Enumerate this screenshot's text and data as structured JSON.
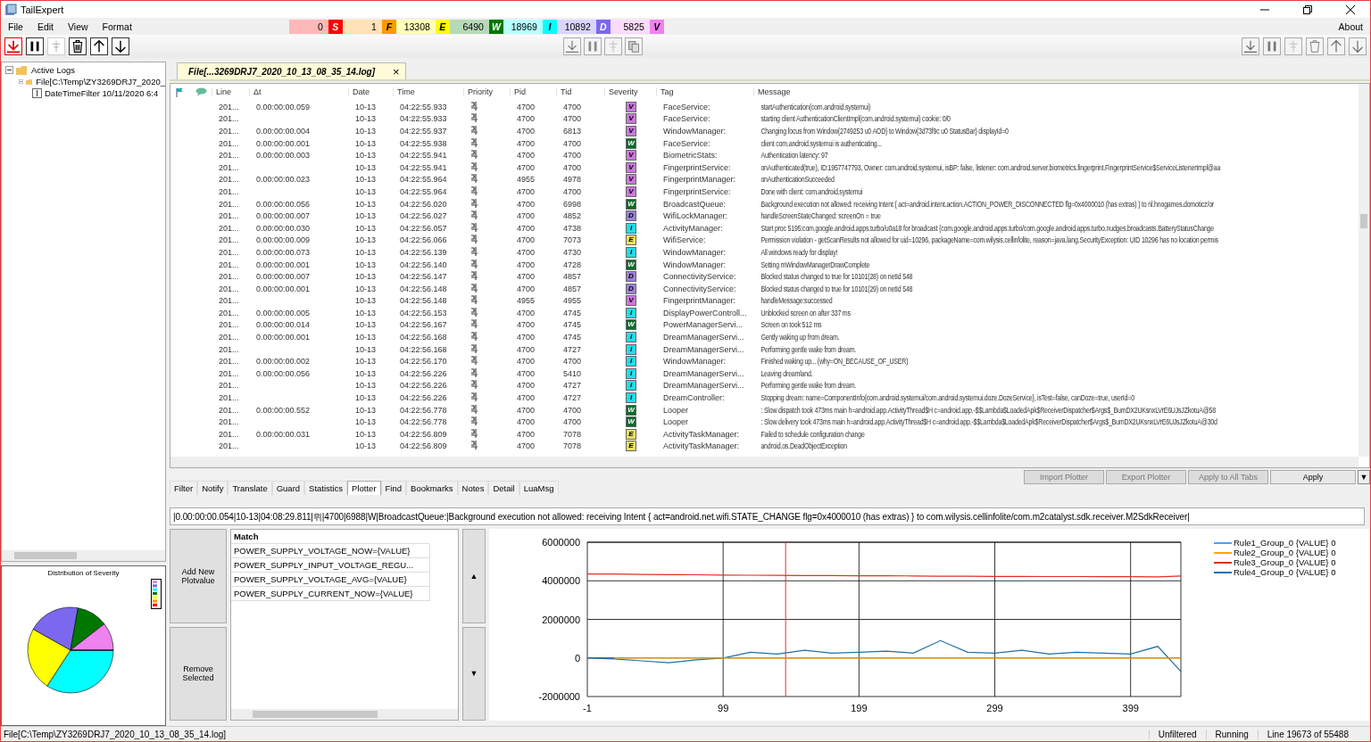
{
  "window": {
    "title": "TailExpert"
  },
  "menu": [
    "File",
    "Edit",
    "View",
    "Format"
  ],
  "menu_right": "About",
  "severity_counts": [
    {
      "count": "0",
      "label": "S",
      "color": "#ff0000"
    },
    {
      "count": "1",
      "label": "F",
      "color": "#ff9900"
    },
    {
      "count": "13308",
      "label": "E",
      "color": "#ffff00"
    },
    {
      "count": "6490",
      "label": "W",
      "color": "#007700"
    },
    {
      "count": "18969",
      "label": "I",
      "color": "#00ffff"
    },
    {
      "count": "10892",
      "label": "D",
      "color": "#7b68ee"
    },
    {
      "count": "5825",
      "label": "V",
      "color": "#ee82ee"
    }
  ],
  "tree": [
    {
      "label": "Active Logs",
      "expanded": true,
      "children": [
        {
          "label": "File[C:\\Temp\\ZY3269DRJ7_2020_",
          "expanded": true,
          "children": [
            {
              "label": "DateTimeFilter 10/11/2020 6:4"
            }
          ]
        }
      ]
    }
  ],
  "pie": {
    "title": "Distribution of Severity"
  },
  "document_tab": {
    "label": "File[...3269DRJ7_2020_10_13_08_35_14.log]",
    "close": "×"
  },
  "log": {
    "columns": [
      "Line",
      "Δt",
      "Date",
      "Time",
      "Priority",
      "Pid",
      "Tid",
      "Severity",
      "Tag",
      "Message"
    ],
    "rows": [
      {
        "line": "201...",
        "delta": "0.00:00:00.059",
        "date": "10-13",
        "time": "04:22:55.933",
        "pid": "4700",
        "tid": "4700",
        "severity": "V",
        "color": "#cc77dd",
        "tag": "FaceService:",
        "message": "startAuthentication(com.android.systemui)"
      },
      {
        "line": "201...",
        "date": "10-13",
        "time": "04:22:55.933",
        "pid": "4700",
        "tid": "4700",
        "severity": "V",
        "color": "#cc77dd",
        "tag": "FaceService:",
        "message": "starting client AuthenticationClientImpl(com.android.systemui) cookie: 0/0"
      },
      {
        "line": "201...",
        "delta": "0.00:00:00.004",
        "date": "10-13",
        "time": "04:22:55.937",
        "pid": "4700",
        "tid": "6813",
        "severity": "V",
        "color": "#cc77dd",
        "tag": "WindowManager:",
        "message": "Changing focus from Window{2749253 u0 AOD} to Window{3d73f9c u0 StatusBar} displayId=0"
      },
      {
        "line": "201...",
        "delta": "0.00:00:00.001",
        "date": "10-13",
        "time": "04:22:55.938",
        "pid": "4700",
        "tid": "4700",
        "severity": "W",
        "color": "#0a6b2a",
        "tag": "FaceService:",
        "message": "client com.android.systemui is authenticating..."
      },
      {
        "line": "201...",
        "delta": "0.00:00:00.003",
        "date": "10-13",
        "time": "04:22:55.941",
        "pid": "4700",
        "tid": "4700",
        "severity": "V",
        "color": "#cc77dd",
        "tag": "BiometricStats:",
        "message": "Authentication latency: 97"
      },
      {
        "line": "201...",
        "date": "10-13",
        "time": "04:22:55.941",
        "pid": "4700",
        "tid": "4700",
        "severity": "V",
        "color": "#cc77dd",
        "tag": "FingerprintService:",
        "message": "onAuthenticated(true), ID:1957747793, Owner: com.android.systemui, isBP: false, listener: com.android.server.biometrics.fingerprint.FingerprintService$ServiceListenerImpl@aa"
      },
      {
        "line": "201...",
        "delta": "0.00:00:00.023",
        "date": "10-13",
        "time": "04:22:55.964",
        "pid": "4955",
        "tid": "4978",
        "severity": "V",
        "color": "#cc77dd",
        "tag": "FingerprintManager:",
        "message": "onAuthenticationSucceeded"
      },
      {
        "line": "201...",
        "date": "10-13",
        "time": "04:22:55.964",
        "pid": "4700",
        "tid": "4700",
        "severity": "V",
        "color": "#cc77dd",
        "tag": "FingerprintService:",
        "message": "Done with client: com.android.systemui"
      },
      {
        "line": "201...",
        "delta": "0.00:00:00.056",
        "date": "10-13",
        "time": "04:22:56.020",
        "pid": "4700",
        "tid": "6998",
        "severity": "W",
        "color": "#0a6b2a",
        "tag": "BroadcastQueue:",
        "message": "Background execution not allowed: receiving Intent { act=android.intent.action.ACTION_POWER_DISCONNECTED flg=0x4000010 (has extras) } to nl.hnogames.domoticz/or"
      },
      {
        "line": "201...",
        "delta": "0.00:00:00.007",
        "date": "10-13",
        "time": "04:22:56.027",
        "pid": "4700",
        "tid": "4852",
        "severity": "D",
        "color": "#9a82d8",
        "tag": "WifiLockManager:",
        "message": "handleScreenStateChanged: screenOn = true"
      },
      {
        "line": "201...",
        "delta": "0.00:00:00.030",
        "date": "10-13",
        "time": "04:22:56.057",
        "pid": "4700",
        "tid": "4738",
        "severity": "I",
        "color": "#22dde8",
        "tag": "ActivityManager:",
        "message": "Start proc 5195:com.google.android.apps.turbo/u0a18 for broadcast {com.google.android.apps.turbo/com.google.android.apps.turbo.nudges.broadcasts.BatteryStatusChange"
      },
      {
        "line": "201...",
        "delta": "0.00:00:00.009",
        "date": "10-13",
        "time": "04:22:56.066",
        "pid": "4700",
        "tid": "7073",
        "severity": "E",
        "color": "#e6e060",
        "tag": "WifiService:",
        "message": "Permission violation - getScanResults not allowed for uid=10296, packageName=com.wilysis.cellinfolite, reason=java.lang.SecurityException: UID 10296 has no location permis"
      },
      {
        "line": "201...",
        "delta": "0.00:00:00.073",
        "date": "10-13",
        "time": "04:22:56.139",
        "pid": "4700",
        "tid": "4730",
        "severity": "I",
        "color": "#22dde8",
        "tag": "WindowManager:",
        "message": "All windows ready for display!"
      },
      {
        "line": "201...",
        "delta": "0.00:00:00.001",
        "date": "10-13",
        "time": "04:22:56.140",
        "pid": "4700",
        "tid": "4728",
        "severity": "W",
        "color": "#0a6b2a",
        "tag": "WindowManager:",
        "message": "Setting mWindowManagerDrawComplete"
      },
      {
        "line": "201...",
        "delta": "0.00:00:00.007",
        "date": "10-13",
        "time": "04:22:56.147",
        "pid": "4700",
        "tid": "4857",
        "severity": "D",
        "color": "#9a82d8",
        "tag": "ConnectivityService:",
        "message": "Blocked status changed to true for 10101(28) on netId 548"
      },
      {
        "line": "201...",
        "delta": "0.00:00:00.001",
        "date": "10-13",
        "time": "04:22:56.148",
        "pid": "4700",
        "tid": "4857",
        "severity": "D",
        "color": "#9a82d8",
        "tag": "ConnectivityService:",
        "message": "Blocked status changed to true for 10101(29) on netId 548"
      },
      {
        "line": "201...",
        "date": "10-13",
        "time": "04:22:56.148",
        "pid": "4955",
        "tid": "4955",
        "severity": "V",
        "color": "#cc77dd",
        "tag": "FingerprintManager:",
        "message": "handleMessage:successed"
      },
      {
        "line": "201...",
        "delta": "0.00:00:00.005",
        "date": "10-13",
        "time": "04:22:56.153",
        "pid": "4700",
        "tid": "4745",
        "severity": "I",
        "color": "#22dde8",
        "tag": "DisplayPowerControll...",
        "message": "Unblocked screen on after 337 ms"
      },
      {
        "line": "201...",
        "delta": "0.00:00:00.014",
        "date": "10-13",
        "time": "04:22:56.167",
        "pid": "4700",
        "tid": "4745",
        "severity": "W",
        "color": "#0a6b2a",
        "tag": "PowerManagerServi...",
        "message": "Screen on took 512 ms"
      },
      {
        "line": "201...",
        "delta": "0.00:00:00.001",
        "date": "10-13",
        "time": "04:22:56.168",
        "pid": "4700",
        "tid": "4745",
        "severity": "I",
        "color": "#22dde8",
        "tag": "DreamManagerServi...",
        "message": "Gently waking up from dream."
      },
      {
        "line": "201...",
        "date": "10-13",
        "time": "04:22:56.168",
        "pid": "4700",
        "tid": "4727",
        "severity": "I",
        "color": "#22dde8",
        "tag": "DreamManagerServi...",
        "message": "Performing gentle wake from dream."
      },
      {
        "line": "201...",
        "delta": "0.00:00:00.002",
        "date": "10-13",
        "time": "04:22:56.170",
        "pid": "4700",
        "tid": "4700",
        "severity": "I",
        "color": "#22dde8",
        "tag": "WindowManager:",
        "message": "Finished waking up... (why=ON_BECAUSE_OF_USER)"
      },
      {
        "line": "201...",
        "delta": "0.00:00:00.056",
        "date": "10-13",
        "time": "04:22:56.226",
        "pid": "4700",
        "tid": "5410",
        "severity": "I",
        "color": "#22dde8",
        "tag": "DreamManagerServi...",
        "message": "Leaving dreamland."
      },
      {
        "line": "201...",
        "date": "10-13",
        "time": "04:22:56.226",
        "pid": "4700",
        "tid": "4727",
        "severity": "I",
        "color": "#22dde8",
        "tag": "DreamManagerServi...",
        "message": "Performing gentle wake from dream."
      },
      {
        "line": "201...",
        "date": "10-13",
        "time": "04:22:56.226",
        "pid": "4700",
        "tid": "4727",
        "severity": "I",
        "color": "#22dde8",
        "tag": "DreamController:",
        "message": "Stopping dream: name=ComponentInfo{com.android.systemui/com.android.systemui.doze.DozeService}, isTest=false, canDoze=true, userId=0"
      },
      {
        "line": "201...",
        "delta": "0.00:00:00.552",
        "date": "10-13",
        "time": "04:22:56.778",
        "pid": "4700",
        "tid": "4700",
        "severity": "W",
        "color": "#0a6b2a",
        "tag": "Looper",
        "message": ": Slow dispatch took 473ms main h=android.app.ActivityThread$H c=android.app.-$$Lambda$LoadedApk$ReceiverDispatcher$Args$_BumDX2UKsnxLVrE6UJsJZkotuA@58"
      },
      {
        "line": "201...",
        "date": "10-13",
        "time": "04:22:56.778",
        "pid": "4700",
        "tid": "4700",
        "severity": "W",
        "color": "#0a6b2a",
        "tag": "Looper",
        "message": ": Slow delivery took 473ms main h=android.app.ActivityThread$H c=android.app.-$$Lambda$LoadedApk$ReceiverDispatcher$Args$_BumDX2UKsnxLVrE6UJsJZkotuA@30d"
      },
      {
        "line": "201...",
        "delta": "0.00:00:00.031",
        "date": "10-13",
        "time": "04:22:56.809",
        "pid": "4700",
        "tid": "7078",
        "severity": "E",
        "color": "#e6e060",
        "tag": "ActivityTaskManager:",
        "message": "Failed to schedule configuration change"
      },
      {
        "line": "201...",
        "date": "10-13",
        "time": "04:22:56.809",
        "pid": "4700",
        "tid": "7078",
        "severity": "E",
        "color": "#e6e060",
        "tag": "ActivityTaskManager:",
        "message": "android.os.DeadObjectException"
      }
    ]
  },
  "bottom_tabs": [
    {
      "label": "Filter",
      "selected": false
    },
    {
      "label": "Notify",
      "selected": false
    },
    {
      "label": "Translate",
      "selected": false
    },
    {
      "label": "Guard",
      "selected": false
    },
    {
      "label": "Statistics",
      "selected": false
    },
    {
      "label": "Plotter",
      "selected": true
    },
    {
      "label": "Find",
      "selected": false
    },
    {
      "label": "Bookmarks",
      "selected": false
    },
    {
      "label": "Notes",
      "selected": false
    },
    {
      "label": "Detail",
      "selected": false
    },
    {
      "label": "LuaMsg",
      "selected": false
    }
  ],
  "plotter_buttons": [
    {
      "label": "Import Plotter",
      "disabled": true
    },
    {
      "label": "Export Plotter",
      "disabled": true
    },
    {
      "label": "Apply to All Tabs",
      "disabled": true
    },
    {
      "label": "Apply",
      "disabled": false
    }
  ],
  "dropdown": "▼",
  "sample_line": "|0.00:00:00.054|10-13|04:08:29.811|뮈|4700|6988|W|BroadcastQueue:|Background execution not allowed: receiving Intent { act=android.net.wifi.STATE_CHANGE flg=0x4000010 (has extras) } to com.wilysis.cellinfolite/com.m2catalyst.sdk.receiver.M2SdkReceiver|",
  "plot_actions": [
    "Add New Plotvalue",
    "Remove Selected"
  ],
  "match": {
    "header": "Match",
    "items": [
      "POWER_SUPPLY_VOLTAGE_NOW={VALUE}",
      "POWER_SUPPLY_INPUT_VOLTAGE_REGU...",
      "POWER_SUPPLY_VOLTAGE_AVG={VALUE}",
      "POWER_SUPPLY_CURRENT_NOW={VALUE}"
    ]
  },
  "move_buttons": [
    "▲",
    "▼"
  ],
  "plot": {
    "chart_data": {
      "type": "line",
      "x": [
        -1,
        19,
        39,
        59,
        79,
        99,
        119,
        139,
        159,
        179,
        199,
        219,
        239,
        259,
        279,
        299,
        319,
        339,
        359,
        379,
        399,
        419,
        436
      ],
      "grid": true,
      "legend": "right",
      "ref_lines": [
        {
          "axis": "x",
          "value": 145
        }
      ],
      "xlim": [
        -1,
        436
      ],
      "ylim": [
        -2000000,
        6000000
      ],
      "xticks": [
        -1,
        99,
        199,
        299,
        399
      ],
      "yticks": [
        -2000000,
        0,
        2000000,
        4000000,
        6000000
      ],
      "series": [
        {
          "name": "Rule1_Group_0 {VALUE} 0",
          "color": "#4aa3ff",
          "values": [
            null,
            null,
            null,
            null,
            null,
            null,
            null,
            null,
            null,
            null,
            null,
            null,
            null,
            null,
            null,
            null,
            null,
            null,
            null,
            null,
            null,
            null,
            null
          ]
        },
        {
          "name": "Rule2_Group_0 {VALUE} 0",
          "color": "#ffa500",
          "values": [
            null,
            0,
            0,
            0,
            0,
            0,
            0,
            0,
            0,
            0,
            0,
            0,
            0,
            0,
            0,
            0,
            0,
            0,
            0,
            0,
            0,
            0,
            0
          ]
        },
        {
          "name": "Rule3_Group_0 {VALUE} 0",
          "color": "#e03020",
          "values": [
            4350000,
            4350000,
            4330000,
            4320000,
            4310000,
            4300000,
            4290000,
            4280000,
            4270000,
            4270000,
            4260000,
            4260000,
            4250000,
            4240000,
            4240000,
            4230000,
            4230000,
            4220000,
            4220000,
            4210000,
            4210000,
            4200000,
            4250000
          ]
        },
        {
          "name": "Rule4_Group_0 {VALUE} 0",
          "color": "#1f6fa8",
          "values": [
            0,
            -50000,
            -150000,
            -250000,
            -100000,
            0,
            300000,
            200000,
            400000,
            250000,
            300000,
            350000,
            250000,
            900000,
            300000,
            250000,
            400000,
            200000,
            300000,
            250000,
            200000,
            600000,
            -700000
          ]
        }
      ]
    }
  },
  "status": {
    "file": "File[C:\\Temp\\ZY3269DRJ7_2020_10_13_08_35_14.log]",
    "filter": "Unfiltered",
    "state": "Running",
    "position": "Line 19673 of 55488"
  }
}
